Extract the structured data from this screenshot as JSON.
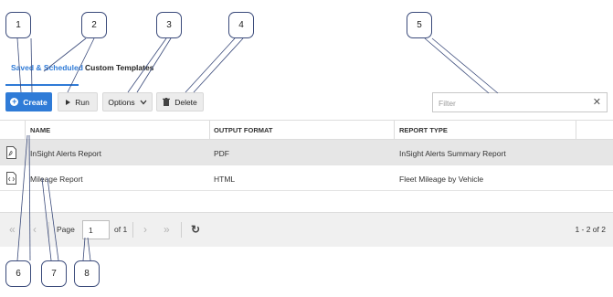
{
  "tabs": [
    {
      "label": "Saved & Scheduled",
      "active": true
    },
    {
      "label": "Custom Templates",
      "active": false
    }
  ],
  "toolbar": {
    "create_label": "Create",
    "run_label": "Run",
    "options_label": "Options",
    "delete_label": "Delete",
    "filter_placeholder": "Filter",
    "clear_glyph": "✕"
  },
  "table": {
    "columns": [
      "NAME",
      "OUTPUT FORMAT",
      "REPORT TYPE"
    ],
    "rows": [
      {
        "icon": "pdf-file-icon",
        "name": "InSight Alerts Report",
        "format": "PDF",
        "type": "InSight Alerts Summary Report",
        "selected": true
      },
      {
        "icon": "html-file-icon",
        "name": "Mileage Report",
        "format": "HTML",
        "type": "Fleet Mileage by Vehicle",
        "selected": false
      }
    ]
  },
  "pager": {
    "page_label": "Page",
    "page_value": "1",
    "of_label": "of 1",
    "range_label": "1 - 2 of 2"
  },
  "callouts": [
    "1",
    "2",
    "3",
    "4",
    "5",
    "6",
    "7",
    "8"
  ],
  "colors": {
    "accent": "#2f7bd7",
    "callout_border": "#3a4a7a"
  }
}
